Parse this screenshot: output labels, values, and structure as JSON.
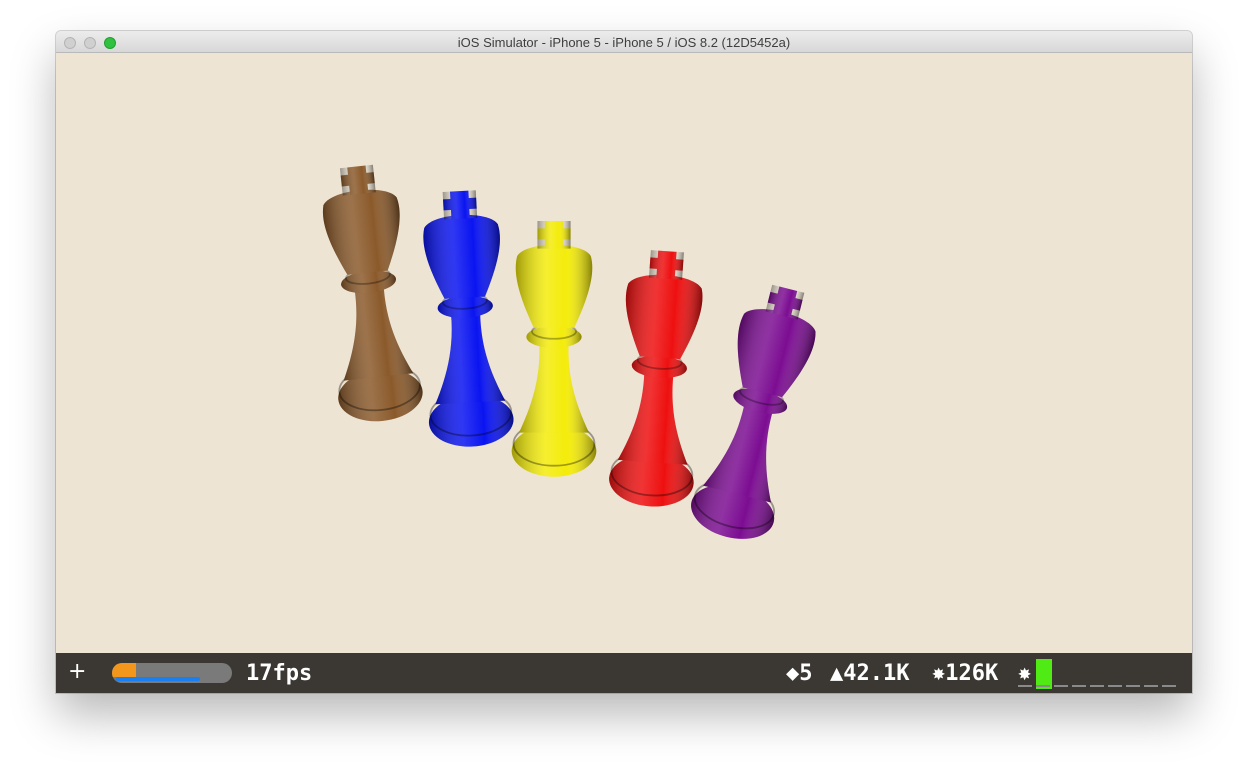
{
  "window": {
    "title": "iOS Simulator - iPhone 5 - iPhone 5 / iOS 8.2 (12D5452a)"
  },
  "scene": {
    "background": "#ede4d3",
    "pieces": [
      {
        "name": "king",
        "color": "#8b5a2b"
      },
      {
        "name": "king",
        "color": "#0a14f0"
      },
      {
        "name": "king",
        "color": "#f4ec0a"
      },
      {
        "name": "king",
        "color": "#ee1010"
      },
      {
        "name": "king",
        "color": "#7c0d92"
      }
    ]
  },
  "stats": {
    "add_button": "+",
    "gauge_progress": 0.2,
    "gauge_secondary": 0.75,
    "fps": "17fps",
    "draw_calls": "◆5",
    "triangles": "▲42.1K",
    "points": "✸126K",
    "lights_icon": "✸"
  },
  "colors": {
    "stats_background": "#3b3833",
    "gauge_orange": "#f2961c",
    "gauge_blue": "#1a7ff0",
    "meter_green": "#50ea15"
  }
}
